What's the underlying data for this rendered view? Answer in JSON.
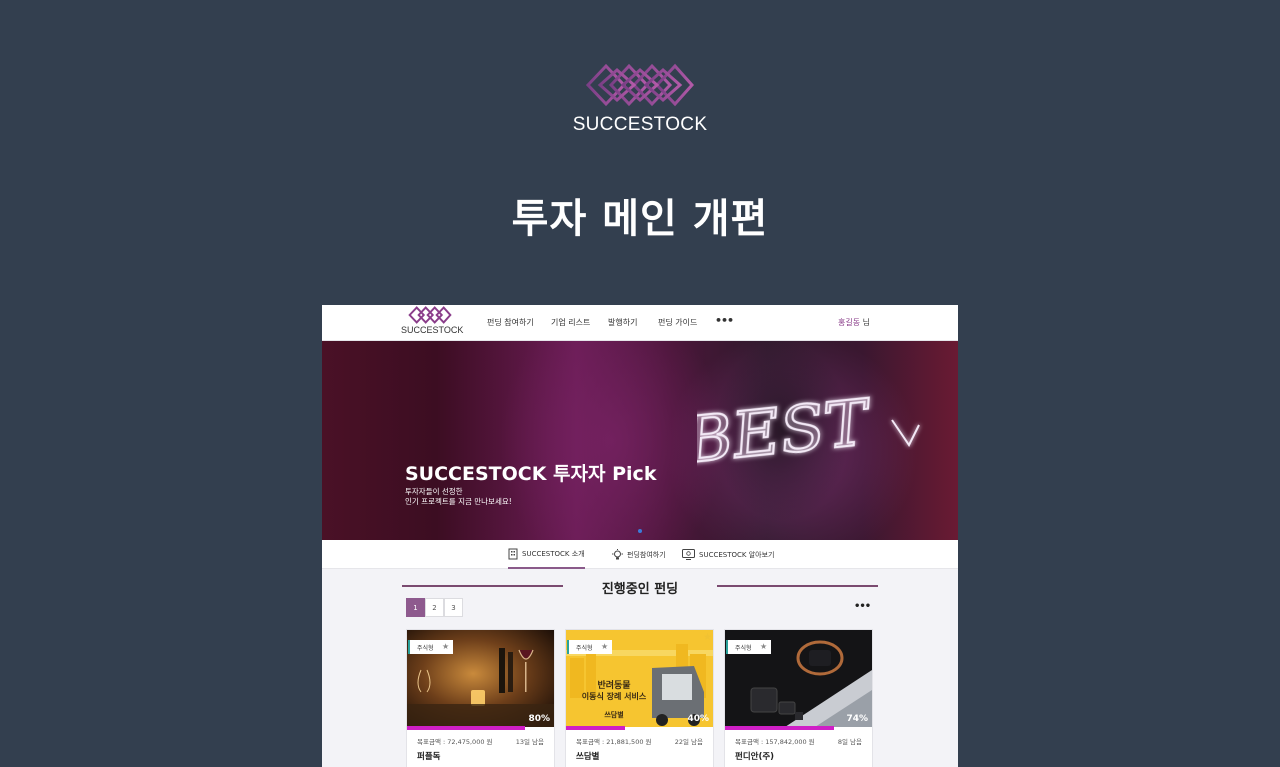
{
  "brand": {
    "name": "SUCCESTOCK",
    "logo_icon": "diamond-lattice-logo",
    "logo_color": "#8a3d8a"
  },
  "page_title": "투자 메인 개편",
  "mockup": {
    "nav": {
      "logo_text": "SUCCESTOCK",
      "items": [
        "펀딩 참여하기",
        "기업 리스트",
        "발행하기",
        "펀딩 가이드"
      ],
      "more": "•••",
      "user_name": "홍길동",
      "user_suffix": " 님"
    },
    "hero": {
      "title": "SUCCESTOCK 투자자 Pick",
      "subtitle_line1": "투자자들이 선정한",
      "subtitle_line2": "인기 프로젝트를 지금 만나보세요!",
      "neon_text": "BEST"
    },
    "subtabs": [
      {
        "label": "SUCCESTOCK 소개",
        "icon": "building-icon"
      },
      {
        "label": "펀딩참여하기",
        "icon": "lightbulb-icon"
      },
      {
        "label": "SUCCESTOCK 알아보기",
        "icon": "monitor-icon"
      }
    ],
    "section": {
      "title": "진행중인 펀딩",
      "pages": [
        "1",
        "2",
        "3"
      ],
      "active_page": "1",
      "more": "•••"
    },
    "cards": [
      {
        "badge": "주식형",
        "percent": "80%",
        "progress": 0.8,
        "goal": "목표금액 : 72,475,000 원",
        "days": "13일 남음",
        "name": "퍼플독"
      },
      {
        "badge": "주식형",
        "percent": "40%",
        "progress": 0.4,
        "goal": "목표금액 : 21,881,500 원",
        "days": "22일 남음",
        "name": "쓰담별",
        "image_text_1": "반려동물",
        "image_text_2": "이동식 장례 서비스",
        "image_text_3": "쓰담별"
      },
      {
        "badge": "주식형",
        "percent": "74%",
        "progress": 0.74,
        "goal": "목표금액 : 157,842,000 원",
        "days": "8일 남음",
        "name": "펀디안(주)"
      }
    ],
    "colors": {
      "accent": "#8e5a8e",
      "progress": "#cf1fc6",
      "badge_border": "#2aa19a"
    }
  }
}
